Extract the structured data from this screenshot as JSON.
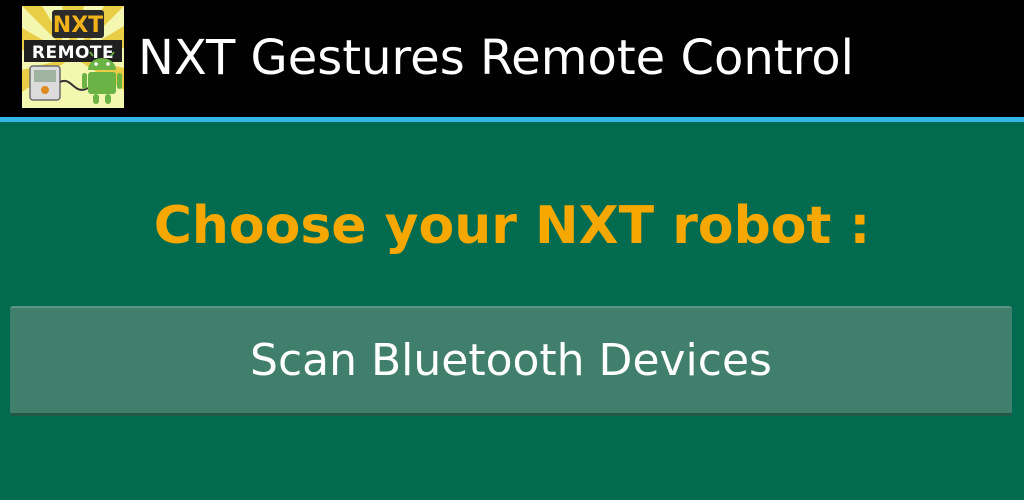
{
  "action_bar": {
    "title": "NXT Gestures Remote Control",
    "icon": {
      "name": "nxt-remote-app-icon",
      "logo_text_top": "NXT",
      "logo_text_bottom": "REMOTE"
    }
  },
  "main": {
    "prompt": "Choose your NXT robot :",
    "scan_button_label": "Scan Bluetooth Devices"
  },
  "colors": {
    "background": "#016b4f",
    "action_bar": "#000000",
    "divider": "#33b5e5",
    "prompt_text": "#f6a800",
    "button": "#3f7f6b"
  }
}
